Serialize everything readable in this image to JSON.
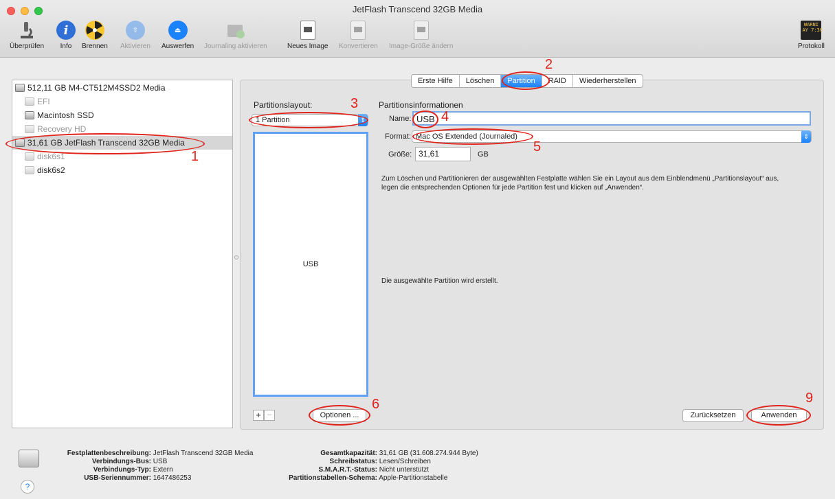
{
  "window": {
    "title": "JetFlash Transcend 32GB Media"
  },
  "toolbar": {
    "items": [
      {
        "label": "Überprüfen",
        "icon": "microscope-icon",
        "enabled": true
      },
      {
        "label": "Info",
        "icon": "info-icon",
        "enabled": true
      },
      {
        "label": "Brennen",
        "icon": "burn-icon",
        "enabled": true
      },
      {
        "label": "Aktivieren",
        "icon": "mount-icon",
        "enabled": false
      },
      {
        "label": "Auswerfen",
        "icon": "eject-icon",
        "enabled": true
      },
      {
        "label": "Journaling aktivieren",
        "icon": "journaling-icon",
        "enabled": false
      },
      {
        "label": "Neues Image",
        "icon": "new-image-icon",
        "enabled": true
      },
      {
        "label": "Konvertieren",
        "icon": "convert-icon",
        "enabled": false
      },
      {
        "label": "Image-Größe ändern",
        "icon": "resize-image-icon",
        "enabled": false
      }
    ],
    "log": {
      "label": "Protokoll",
      "icon_text": "WARNI\nAY 7:36"
    }
  },
  "sidebar": {
    "items": [
      {
        "label": "512,11 GB M4-CT512M4SSD2 Media",
        "muted": false,
        "selected": false
      },
      {
        "label": "EFI",
        "muted": true,
        "selected": false
      },
      {
        "label": "Macintosh SSD",
        "muted": false,
        "selected": false
      },
      {
        "label": "Recovery HD",
        "muted": true,
        "selected": false
      },
      {
        "label": "31,61 GB JetFlash Transcend 32GB Media",
        "muted": false,
        "selected": true
      },
      {
        "label": "disk6s1",
        "muted": true,
        "selected": false
      },
      {
        "label": "disk6s2",
        "muted": false,
        "selected": false
      }
    ]
  },
  "tabs": [
    "Erste Hilfe",
    "Löschen",
    "Partition",
    "RAID",
    "Wiederherstellen"
  ],
  "active_tab": "Partition",
  "partition": {
    "layout_label": "Partitionslayout:",
    "layout_value": "1 Partition",
    "layout_partition_name": "USB",
    "info_title": "Partitionsinformationen",
    "name_label": "Name:",
    "name_value": "USB",
    "format_label": "Format:",
    "format_value": "Mac OS Extended (Journaled)",
    "size_label": "Größe:",
    "size_value": "31,61",
    "size_unit": "GB",
    "help_text": "Zum Löschen und Partitionieren der ausgewählten Festplatte wählen Sie ein Layout aus dem Einblendmenü „Partitionslayout“ aus, legen die entsprechenden Optionen für jede Partition fest und klicken auf „Anwenden“.",
    "status_text": "Die ausgewählte Partition wird erstellt.",
    "add_label": "+",
    "remove_label": "−",
    "options_label": "Optionen ...",
    "revert_label": "Zurücksetzen",
    "apply_label": "Anwenden"
  },
  "annotations": [
    "1",
    "2",
    "3",
    "4",
    "5",
    "6",
    "9"
  ],
  "footer": {
    "left": [
      {
        "key": "Festplattenbeschreibung:",
        "value": "JetFlash Transcend 32GB Media"
      },
      {
        "key": "Verbindungs-Bus:",
        "value": "USB"
      },
      {
        "key": "Verbindungs-Typ:",
        "value": "Extern"
      },
      {
        "key": "USB-Seriennummer:",
        "value": "1647486253"
      }
    ],
    "right": [
      {
        "key": "Gesamtkapazität:",
        "value": "31,61 GB (31.608.274.944 Byte)"
      },
      {
        "key": "Schreibstatus:",
        "value": "Lesen/Schreiben"
      },
      {
        "key": "S.M.A.R.T.-Status:",
        "value": "Nicht unterstützt"
      },
      {
        "key": "Partitionstabellen-Schema:",
        "value": "Apple-Partitionstabelle"
      }
    ],
    "help_label": "?"
  },
  "colors": {
    "accent": "#1a82fb",
    "annotation": "#e0231b",
    "selection": "#d6d6d6"
  }
}
